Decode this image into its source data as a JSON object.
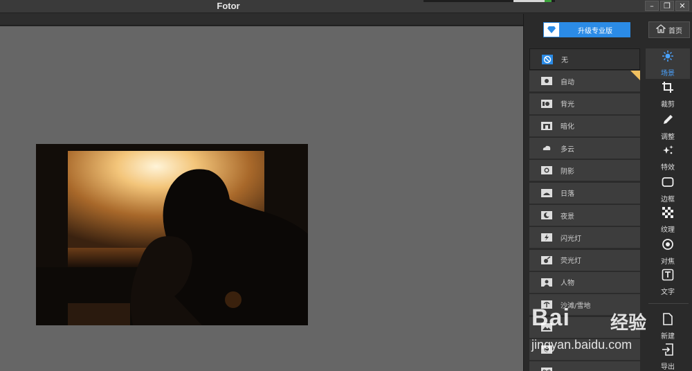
{
  "app": {
    "title": "Fotor"
  },
  "window_buttons": {
    "minimize": "–",
    "restore": "❐",
    "close": "✕"
  },
  "header": {
    "upgrade_label": "升级专业版",
    "home_label": "首页"
  },
  "scenes": [
    {
      "label": "无",
      "icon": "none-icon",
      "active": true
    },
    {
      "label": "自动",
      "icon": "camera-icon",
      "premium": true
    },
    {
      "label": "背光",
      "icon": "backlight-icon"
    },
    {
      "label": "暗化",
      "icon": "darken-icon"
    },
    {
      "label": "多云",
      "icon": "cloud-icon"
    },
    {
      "label": "阴影",
      "icon": "shadow-icon"
    },
    {
      "label": "日落",
      "icon": "sunset-icon"
    },
    {
      "label": "夜景",
      "icon": "moon-icon"
    },
    {
      "label": "闪光灯",
      "icon": "flash-icon"
    },
    {
      "label": "荧光灯",
      "icon": "fluorescent-icon"
    },
    {
      "label": "人物",
      "icon": "portrait-icon"
    },
    {
      "label": "沙滩/雪地",
      "icon": "beach-icon"
    },
    {
      "label": "",
      "icon": "landscape-icon"
    },
    {
      "label": "",
      "icon": "food-icon"
    },
    {
      "label": "",
      "icon": "plant-icon"
    }
  ],
  "tools": [
    {
      "label": "场景",
      "icon": "scene-icon",
      "active": true
    },
    {
      "label": "裁剪",
      "icon": "crop-icon"
    },
    {
      "label": "调整",
      "icon": "adjust-icon"
    },
    {
      "label": "特效",
      "icon": "effects-icon"
    },
    {
      "label": "边框",
      "icon": "border-icon"
    },
    {
      "label": "纹理",
      "icon": "texture-icon"
    },
    {
      "label": "对焦",
      "icon": "focus-icon"
    },
    {
      "label": "文字",
      "icon": "text-icon"
    },
    {
      "label": "新建",
      "icon": "new-file-icon"
    },
    {
      "label": "导出",
      "icon": "export-icon"
    }
  ],
  "watermark": {
    "brand": "Bai",
    "brand_cn": "经验",
    "url": "jingyan.baidu.com"
  },
  "colors": {
    "accent": "#2b8be6",
    "active_tool": "#4aa3ff",
    "premium": "#f0c060"
  }
}
